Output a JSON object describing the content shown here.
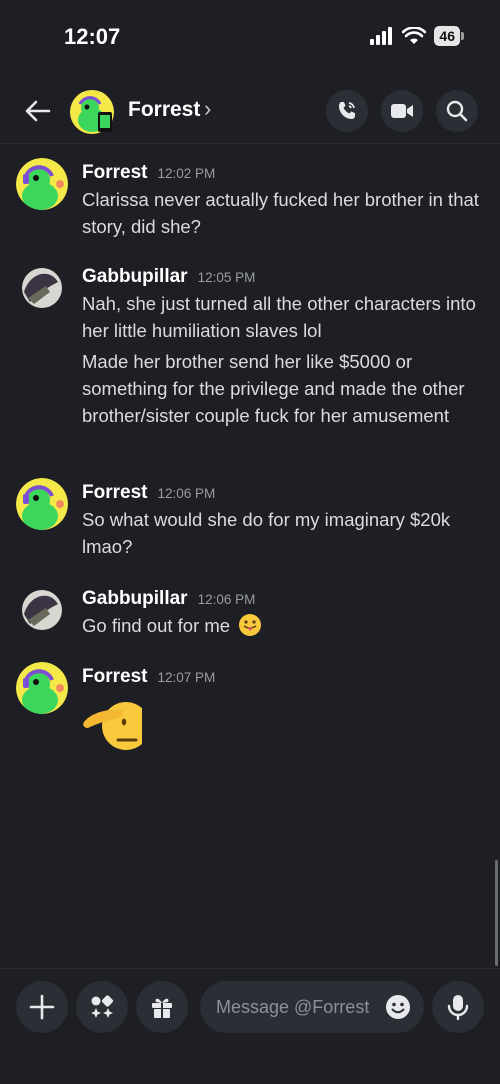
{
  "status_bar": {
    "time": "12:07",
    "battery": "46"
  },
  "header": {
    "name": "Forrest",
    "chevron": "›"
  },
  "messages": [
    {
      "author": "Forrest",
      "time": "12:02 PM",
      "lines": [
        "Clarissa never actually fucked her brother in that story, did she?"
      ]
    },
    {
      "author": "Gabbupillar",
      "time": "12:05 PM",
      "lines": [
        "Nah, she just turned all the other characters into her little humiliation slaves lol",
        "Made her brother send her like $5000 or something for the privilege and made the other brother/sister couple fuck for her amusement"
      ]
    },
    {
      "author": "Forrest",
      "time": "12:06 PM",
      "lines": [
        "So what would she do for my imaginary $20k lmao?"
      ]
    },
    {
      "author": "Gabbupillar",
      "time": "12:06 PM",
      "lines": [
        "Go find out for me"
      ]
    },
    {
      "author": "Forrest",
      "time": "12:07 PM",
      "lines": []
    }
  ],
  "icons": {
    "back": "arrow-left-icon",
    "call": "phone-call-icon",
    "video": "video-camera-icon",
    "search": "search-icon",
    "add": "plus-icon",
    "apps": "apps-sparkle-icon",
    "gift": "gift-icon",
    "emoji": "emoji-icon",
    "mic": "microphone-icon",
    "tongue_emoji": "tongue-face-emoji",
    "salute_emoji": "saluting-face-emoji"
  },
  "input": {
    "placeholder": "Message @Forrest"
  },
  "colors": {
    "background": "#1e1f24",
    "accent_green": "#3dd65c",
    "avatar_yellow": "#f5e94a"
  }
}
